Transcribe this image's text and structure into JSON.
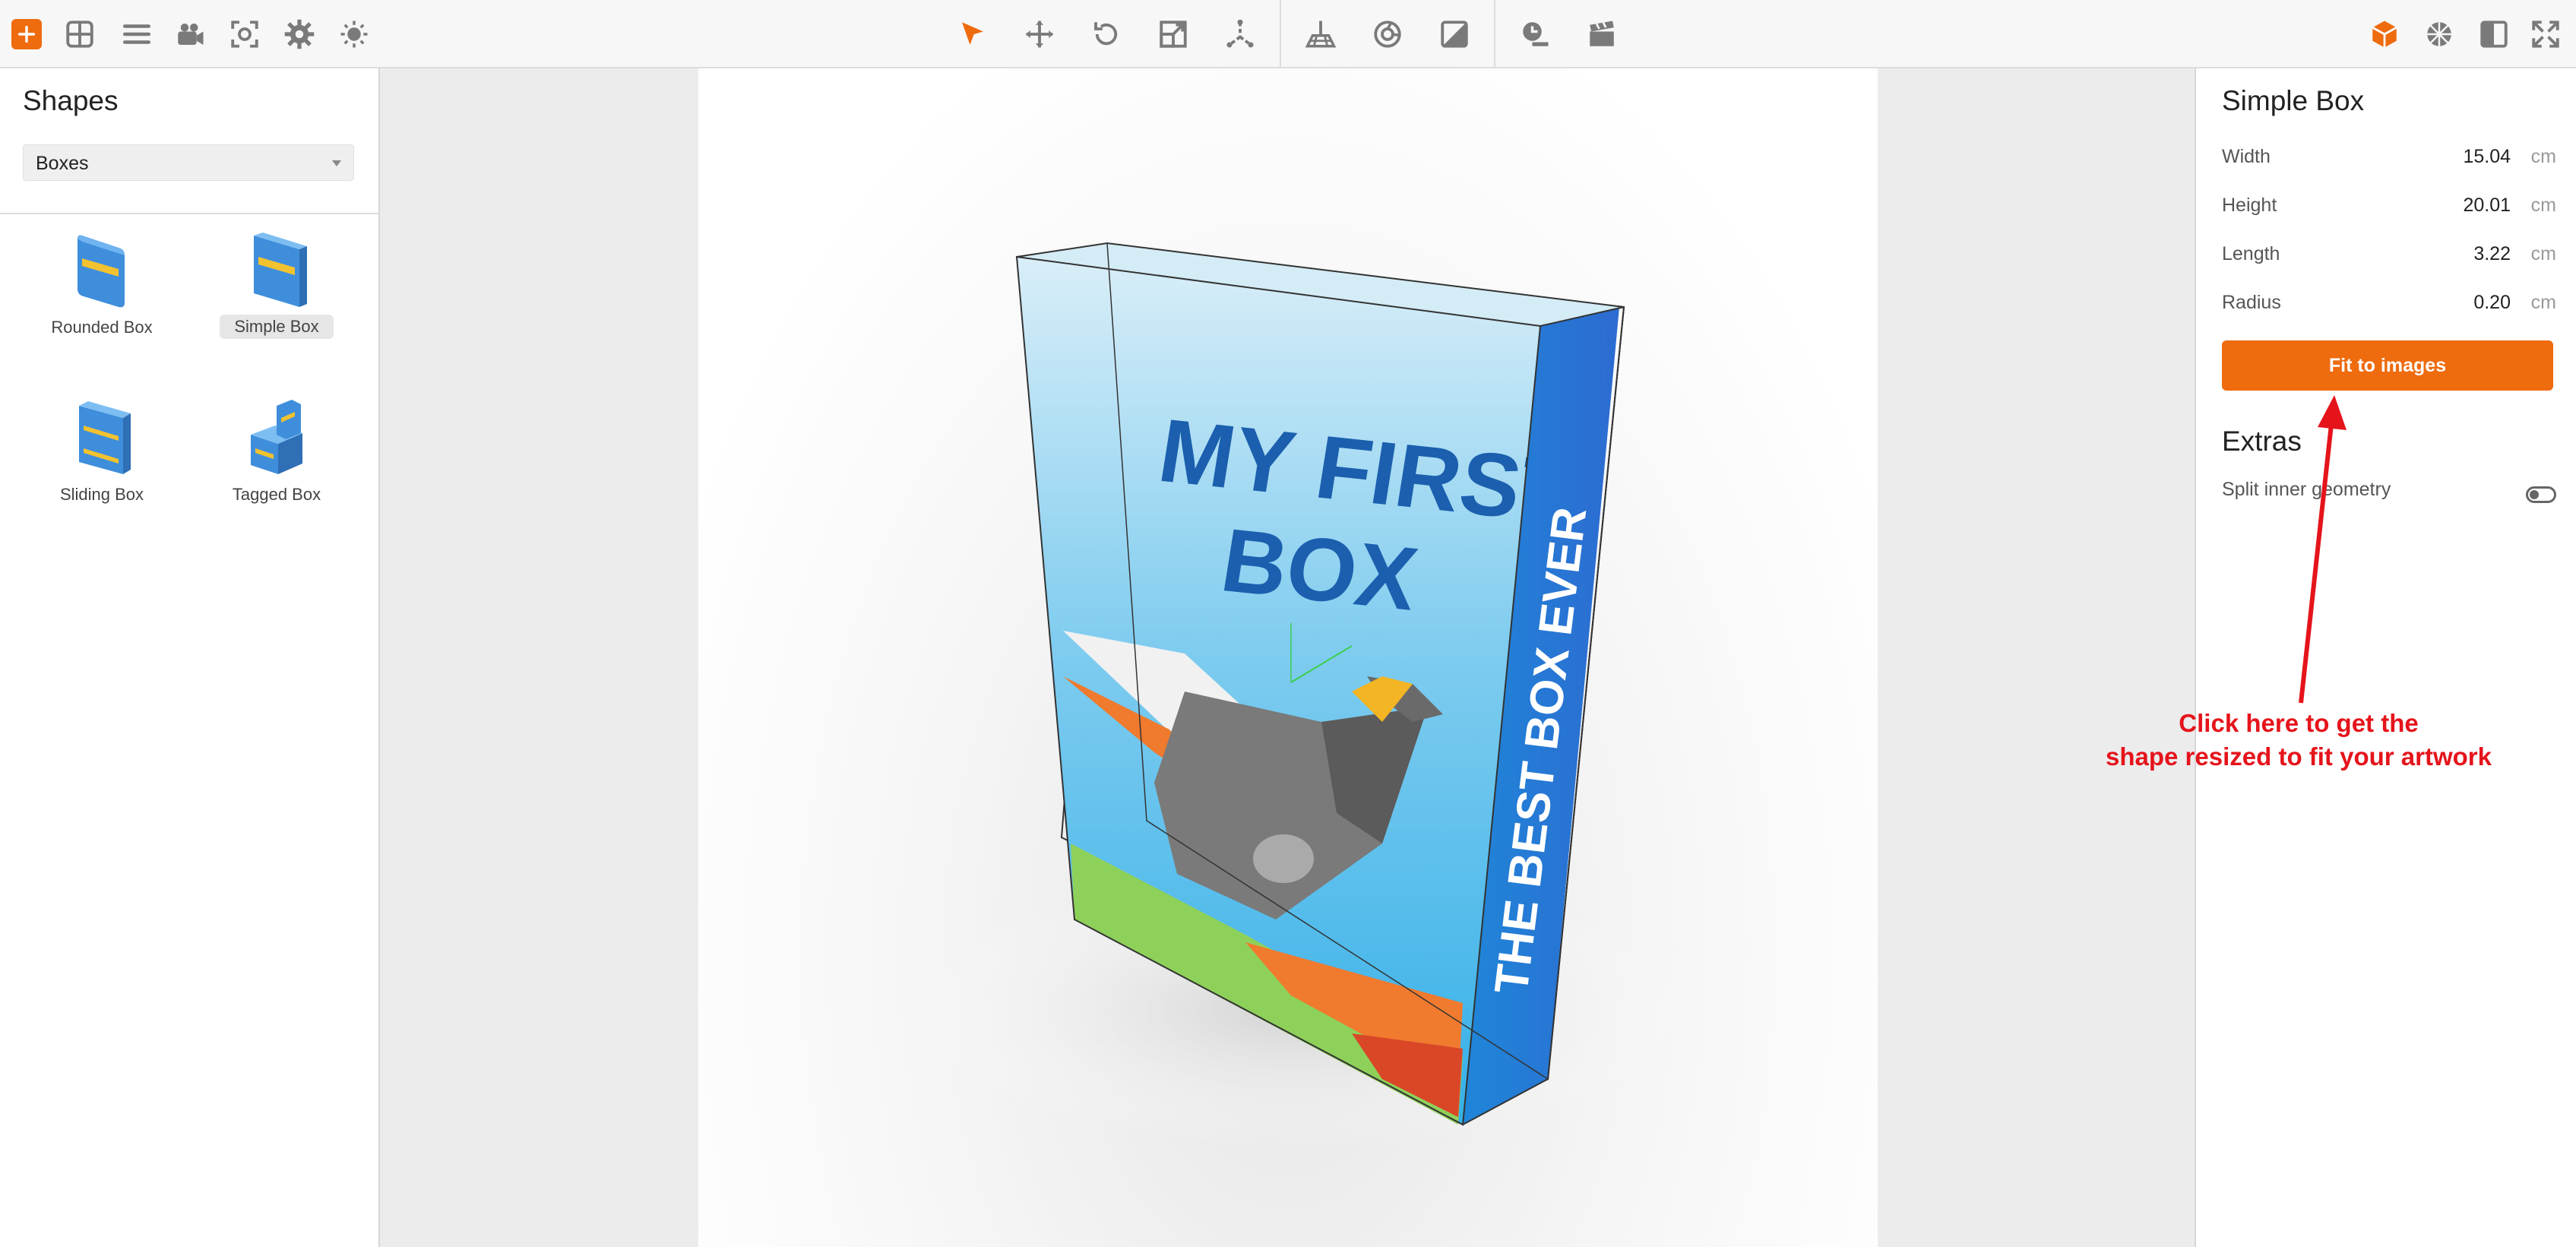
{
  "toolbar": {
    "left_icons": [
      "add-icon",
      "grid-icon",
      "list-icon",
      "camera-icon",
      "focus-icon",
      "gear-icon",
      "light-icon"
    ],
    "center_icons": [
      "select-arrow-icon",
      "move-icon",
      "rotate-icon",
      "scale-icon",
      "axes-icon",
      "floor-grid-icon",
      "material-icon",
      "gradient-icon",
      "time-icon",
      "clapperboard-icon"
    ],
    "right_icons": [
      "box-icon",
      "ball-icon",
      "panel-layout-icon",
      "fullscreen-icon"
    ],
    "accent_color": "#ee6b0e"
  },
  "left_panel": {
    "title": "Shapes",
    "category": "Boxes",
    "shapes": [
      {
        "label": "Rounded Box",
        "icon": "rounded-box-icon"
      },
      {
        "label": "Simple Box",
        "icon": "simple-box-icon",
        "selected": true
      },
      {
        "label": "Sliding Box",
        "icon": "sliding-box-icon"
      },
      {
        "label": "Tagged Box",
        "icon": "tagged-box-icon"
      }
    ]
  },
  "viewport": {
    "box_front_title_line1": "MY FIRST",
    "box_front_title_line2": "BOX",
    "box_side_text": "THE BEST BOX EVER"
  },
  "right_panel": {
    "title": "Simple Box",
    "properties": [
      {
        "label": "Width",
        "value": "15.04",
        "unit": "cm"
      },
      {
        "label": "Height",
        "value": "20.01",
        "unit": "cm"
      },
      {
        "label": "Length",
        "value": "3.22",
        "unit": "cm"
      },
      {
        "label": "Radius",
        "value": "0.20",
        "unit": "cm"
      }
    ],
    "fit_button_label": "Fit to images",
    "extras_title": "Extras",
    "extras_toggle_label": "Split inner geometry",
    "extras_toggle_on": false
  },
  "annotation": {
    "line1": "Click here to get the",
    "line2": "shape resized to fit your artwork",
    "color": "#e5141b"
  }
}
